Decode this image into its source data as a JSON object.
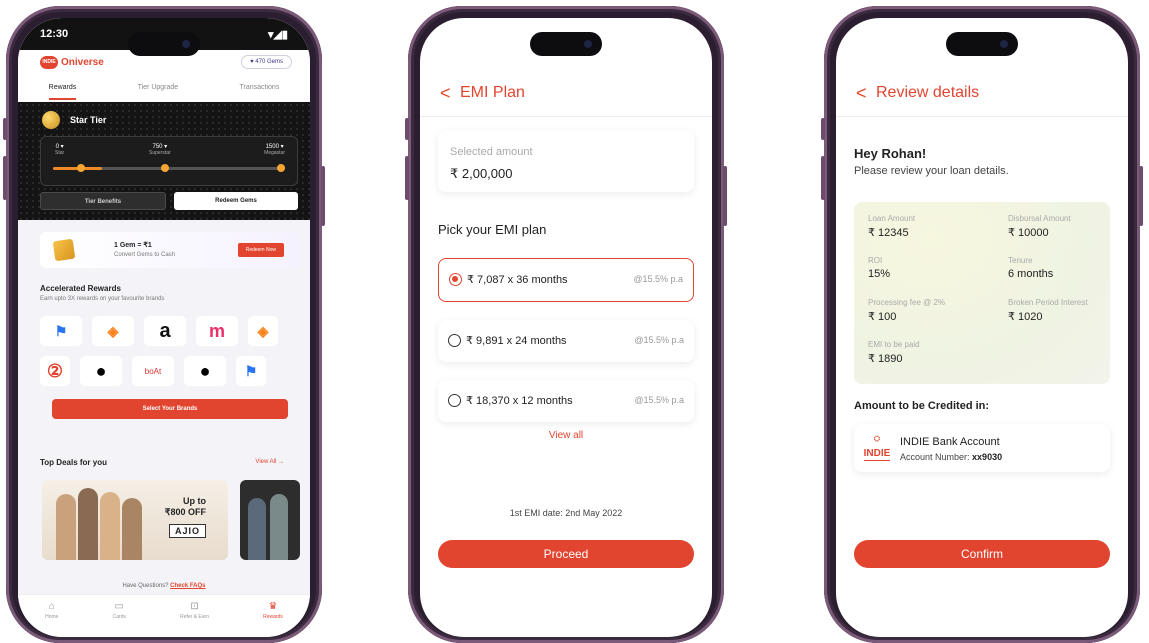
{
  "phone1": {
    "status_time": "12:30",
    "status_icons": "▾◢▮",
    "brand_logo": "INDIE",
    "brand_name": "Oniverse",
    "gems_pill": "♥ 470 Gems",
    "tabs": [
      "Rewards",
      "Tier Upgrade",
      "Transactions"
    ],
    "tier_title": "Star Tier",
    "tier_levels": [
      {
        "value": "0 ▾",
        "name": "Star"
      },
      {
        "value": "750 ▾",
        "name": "Superstar"
      },
      {
        "value": "1500 ▾",
        "name": "Megastar"
      }
    ],
    "tier_progress": 0.21,
    "tier_benefits_label": "Tier Benefits",
    "redeem_gems_label": "Redeem Gems",
    "conversion_title": "1 Gem = ₹1",
    "conversion_sub": "Convert Gems to Cash",
    "redeem_now_label": "Redeem Now",
    "accelerated_title": "Accelerated Rewards",
    "accelerated_sub": "Earn upto 3X rewards on your favourite brands",
    "brands_row1": [
      "flipkart-icon",
      "swiggy-icon",
      "amazon-icon",
      "myntra-icon",
      "swiggy-icon"
    ],
    "brands_row1_glyphs": [
      "⚑",
      "◈",
      "a",
      "m",
      "◈"
    ],
    "brands_row2": [
      "brand-2-icon",
      "ola-icon",
      "boat-icon",
      "ola-icon",
      "flipkart-icon"
    ],
    "brands_row2_glyphs": [
      "②",
      "●",
      "boAt",
      "●",
      "⚑"
    ],
    "select_brands_label": "Select Your Brands",
    "top_deals_title": "Top Deals for you",
    "view_all_label": "View All →",
    "deal_offer": "Up to\n₹800 OFF",
    "deal_brand": "AJIO",
    "questions_text": "Have Questions?",
    "faq_link": "Check FAQs",
    "nav_items": [
      {
        "icon": "⌂",
        "label": "Home"
      },
      {
        "icon": "▭",
        "label": "Cards"
      },
      {
        "icon": "⊡",
        "label": "Refer & Earn"
      },
      {
        "icon": "♛",
        "label": "Rewards"
      }
    ],
    "colors": {
      "accent": "#e2452f",
      "dark": "#141414",
      "gold": "#f4a534"
    }
  },
  "phone2": {
    "back_glyph": "<",
    "title": "EMI Plan",
    "selected_amount_label": "Selected amount",
    "selected_amount": "₹ 2,00,000",
    "pick_title": "Pick your EMI plan",
    "plans": [
      {
        "amount": "₹ 7,087  x  36 months",
        "rate": "@15.5% p.a",
        "selected": true
      },
      {
        "amount": "₹ 9,891  x  24 months",
        "rate": "@15.5% p.a",
        "selected": false
      },
      {
        "amount": "₹ 18,370  x  12 months",
        "rate": "@15.5% p.a",
        "selected": false
      }
    ],
    "view_all": "View all",
    "first_emi": "1st EMI date: 2nd May 2022",
    "proceed_label": "Proceed"
  },
  "phone3": {
    "back_glyph": "<",
    "title": "Review details",
    "greeting": "Hey Rohan!",
    "sub": "Please review your loan details.",
    "details": [
      {
        "k": "Loan Amount",
        "v": "₹ 12345"
      },
      {
        "k": "Disbursal Amount",
        "v": "₹ 10000"
      },
      {
        "k": "ROI",
        "v": "15%"
      },
      {
        "k": "Tenure",
        "v": "6 months"
      },
      {
        "k": "Processing fee @ 2%",
        "v": "₹ 100"
      },
      {
        "k": "Broken Period Interest",
        "v": "₹ 1020"
      },
      {
        "k": "EMI to be paid",
        "v": "₹ 1890"
      }
    ],
    "credit_label": "Amount to be Credited in:",
    "bank_logo_word": "INDIE",
    "bank_name": "INDIE Bank Account",
    "account_prefix": "Account Number:",
    "account_number": "xx9030",
    "confirm_label": "Confirm"
  }
}
